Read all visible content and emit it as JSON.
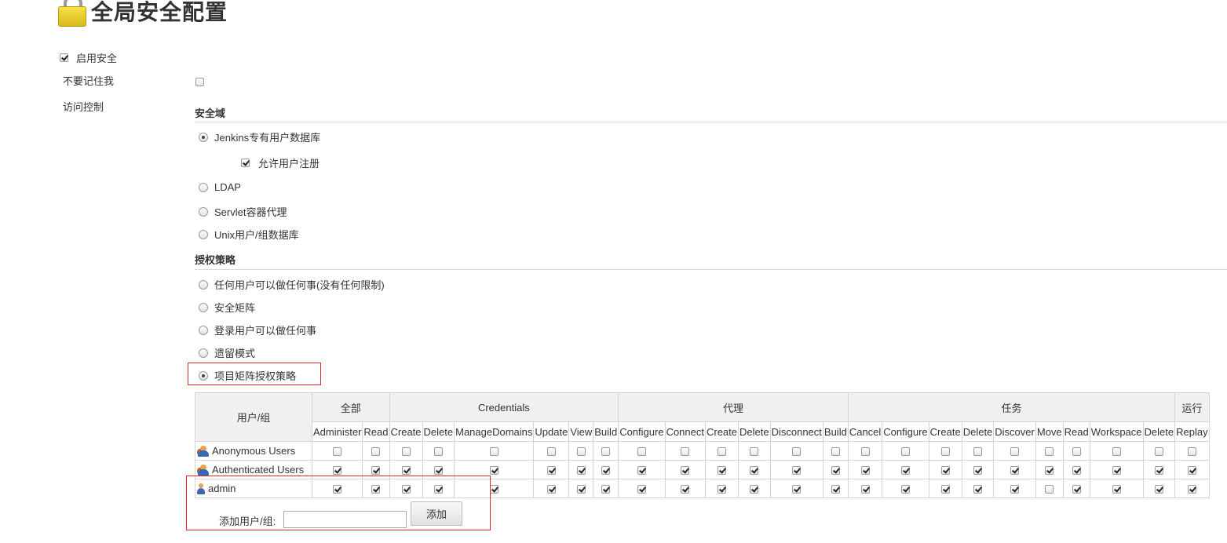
{
  "page": {
    "title": "全局安全配置",
    "icon": "lock-icon"
  },
  "enable_security": {
    "label": "启用安全",
    "checked": true
  },
  "remember_me": {
    "label": "不要记住我",
    "checked": false
  },
  "access_control": {
    "label": "访问控制"
  },
  "security_realm": {
    "heading": "安全域",
    "options": [
      {
        "label": "Jenkins专有用户数据库",
        "selected": true
      },
      {
        "label": "LDAP",
        "selected": false
      },
      {
        "label": "Servlet容器代理",
        "selected": false
      },
      {
        "label": "Unix用户/组数据库",
        "selected": false
      }
    ],
    "allow_signup": {
      "label": "允许用户注册",
      "checked": true
    }
  },
  "authorization": {
    "heading": "授权策略",
    "options": [
      {
        "label": "任何用户可以做任何事(没有任何限制)",
        "selected": false
      },
      {
        "label": "安全矩阵",
        "selected": false
      },
      {
        "label": "登录用户可以做任何事",
        "selected": false
      },
      {
        "label": "遗留模式",
        "selected": false
      },
      {
        "label": "项目矩阵授权策略",
        "selected": true
      }
    ]
  },
  "matrix": {
    "user_header": "用户/组",
    "groups": [
      {
        "label": "全部",
        "span": 2
      },
      {
        "label": "Credentials",
        "span": 6
      },
      {
        "label": "代理",
        "span": 6
      },
      {
        "label": "任务",
        "span": 9
      },
      {
        "label": "运行",
        "span": 2
      }
    ],
    "permissions": [
      "Administer",
      "Read",
      "Create",
      "Delete",
      "ManageDomains",
      "Update",
      "View",
      "Build",
      "Configure",
      "Connect",
      "Create",
      "Delete",
      "Disconnect",
      "Build",
      "Cancel",
      "Configure",
      "Create",
      "Delete",
      "Discover",
      "Move",
      "Read",
      "Workspace",
      "Delete",
      "Replay"
    ],
    "rows": [
      {
        "name": "Anonymous Users",
        "icon": "user-group-icon",
        "checks": [
          false,
          false,
          false,
          false,
          false,
          false,
          false,
          false,
          false,
          false,
          false,
          false,
          false,
          false,
          false,
          false,
          false,
          false,
          false,
          false,
          false,
          false,
          false,
          false
        ]
      },
      {
        "name": "Authenticated Users",
        "icon": "user-group-icon",
        "checks": [
          true,
          true,
          true,
          true,
          true,
          true,
          true,
          true,
          true,
          true,
          true,
          true,
          true,
          true,
          true,
          true,
          true,
          true,
          true,
          true,
          true,
          true,
          true,
          true
        ]
      },
      {
        "name": "admin",
        "icon": "user-icon",
        "checks": [
          true,
          true,
          true,
          true,
          true,
          true,
          true,
          true,
          true,
          true,
          true,
          true,
          true,
          true,
          true,
          true,
          true,
          true,
          true,
          false,
          true,
          true,
          true,
          true
        ]
      }
    ]
  },
  "add_user": {
    "label": "添加用户/组:",
    "input_value": "",
    "button_label": "添加"
  },
  "colors": {
    "highlight_border": "#e0282e",
    "table_header_bg": "#f0f0f0"
  }
}
